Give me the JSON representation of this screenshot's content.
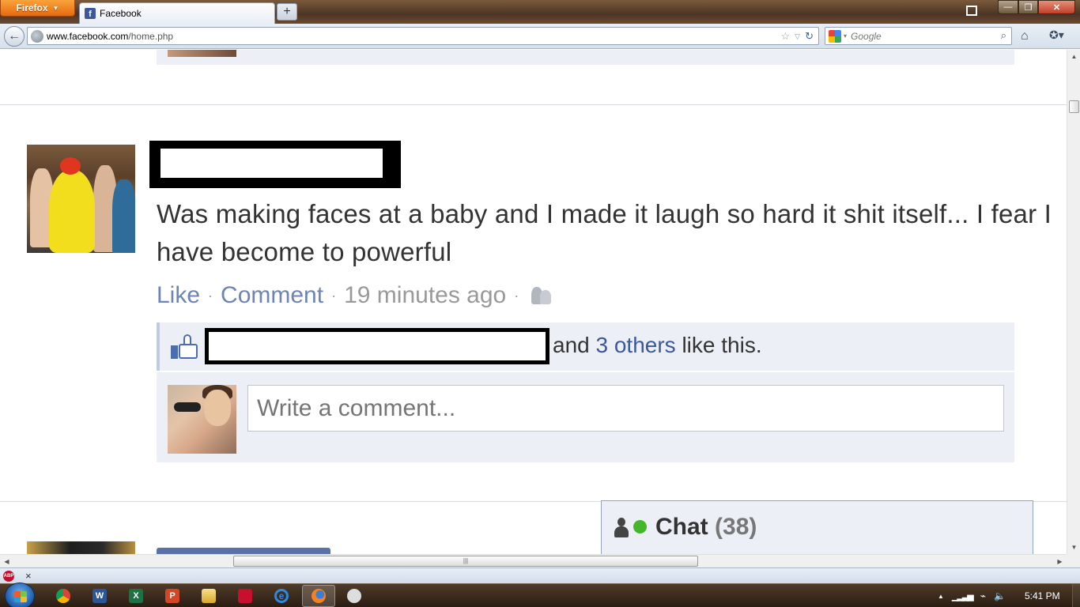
{
  "browser": {
    "menu_button": "Firefox",
    "tab_title": "Facebook",
    "new_tab": "+",
    "url_host": "www.facebook.com",
    "url_path": "/home.php",
    "search_placeholder": "Google",
    "window_controls": {
      "minimize": "—",
      "maximize": "❐",
      "close": "✕"
    }
  },
  "post": {
    "text": "Was making faces at a baby and I made it laugh so hard it shit itself... I fear I have become to powerful",
    "actions": {
      "like": "Like",
      "comment": "Comment",
      "separator": "·",
      "time": "19 minutes ago"
    },
    "likes": {
      "and": "and",
      "others_link": "3 others",
      "suffix": "like this."
    },
    "comment_placeholder": "Write a comment..."
  },
  "chat": {
    "label": "Chat",
    "count": "(38)"
  },
  "taskbar": {
    "clock": "5:41 PM"
  },
  "icons": {
    "back": "back-arrow-icon",
    "globe": "site-identity-globe-icon",
    "bookmark_star": "bookmark-star-icon",
    "reload": "reload-icon",
    "search": "magnifier-icon",
    "home": "home-icon",
    "bookmarks_menu": "bookmarks-menu-icon",
    "thumbs_up": "thumbs-up-icon",
    "audience": "friends-audience-icon",
    "chat_person": "chat-person-icon",
    "online": "online-dot-icon"
  },
  "colors": {
    "facebook_blue": "#3b5998",
    "link_blue": "#6d84b4",
    "panel_bg": "#eceff5",
    "online_green": "#42b72a",
    "firefox_orange": "#e46b0f"
  }
}
